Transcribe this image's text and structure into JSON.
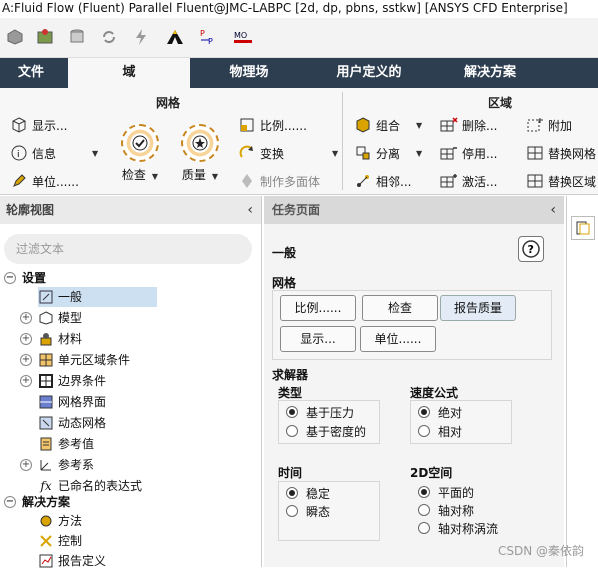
{
  "window": {
    "title": "A:Fluid Flow (Fluent) Parallel Fluent@JMC-LABPC  [2d, dp, pbns, sstkw] [ANSYS CFD Enterprise]"
  },
  "toolbar": {
    "icons": [
      "cube-icon",
      "mesh-icon",
      "cylinder-icon",
      "refresh-icon",
      "lightning-icon",
      "ansys-logo-icon",
      "pp-icon",
      "mo-icon"
    ]
  },
  "tabs": [
    "文件",
    "域",
    "物理场",
    "用户定义的",
    "解决方案"
  ],
  "ribbon": {
    "mesh_group": "网格",
    "zone_group": "区域",
    "display": "显示...",
    "info": "信息",
    "units": "单位......",
    "check": "检查",
    "quality": "质量",
    "scale": "比例......",
    "transform": "变换",
    "make_polyhedra": "制作多面体",
    "combine": "组合",
    "separate": "分离",
    "adjacency": "相邻...",
    "delete": "删除...",
    "deactivate": "停用...",
    "activate": "激活...",
    "append": "附加",
    "replace_mesh": "替换网格",
    "replace_zone": "替换区域"
  },
  "outline": {
    "title": "轮廓视图",
    "filter_placeholder": "过滤文本",
    "items": [
      {
        "label": "设置",
        "bold": true
      },
      {
        "label": "一般"
      },
      {
        "label": "模型"
      },
      {
        "label": "材料"
      },
      {
        "label": "单元区域条件"
      },
      {
        "label": "边界条件"
      },
      {
        "label": "网格界面"
      },
      {
        "label": "动态网格"
      },
      {
        "label": "参考值"
      },
      {
        "label": "参考系"
      },
      {
        "label": "已命名的表达式"
      },
      {
        "label": "解决方案",
        "bold": true
      },
      {
        "label": "方法"
      },
      {
        "label": "控制"
      },
      {
        "label": "报告定义"
      }
    ]
  },
  "task": {
    "title": "任务页面",
    "general": "一般",
    "help": "?",
    "mesh_label": "网格",
    "btn_scale": "比例......",
    "btn_check": "检查",
    "btn_report_quality": "报告质量",
    "btn_display": "显示...",
    "btn_units": "单位......",
    "solver_label": "求解器",
    "type_label": "类型",
    "type_pressure": "基于压力",
    "type_density": "基于密度的",
    "velocity_label": "速度公式",
    "vel_absolute": "绝对",
    "vel_relative": "相对",
    "time_label": "时间",
    "time_steady": "稳定",
    "time_transient": "瞬态",
    "space_label": "2D空间",
    "space_planar": "平面的",
    "space_axisym": "轴对称",
    "space_axisym_swirl": "轴对称涡流"
  },
  "watermark": "CSDN @秦依韵"
}
